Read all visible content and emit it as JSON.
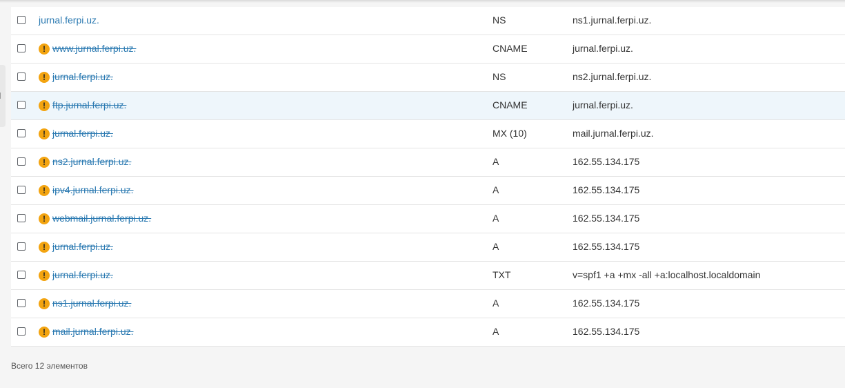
{
  "records": [
    {
      "host": "jurnal.ferpi.uz.",
      "type": "NS",
      "value": "ns1.jurnal.ferpi.uz.",
      "warning": false
    },
    {
      "host": "www.jurnal.ferpi.uz.",
      "type": "CNAME",
      "value": "jurnal.ferpi.uz.",
      "warning": true
    },
    {
      "host": "jurnal.ferpi.uz.",
      "type": "NS",
      "value": "ns2.jurnal.ferpi.uz.",
      "warning": true
    },
    {
      "host": "ftp.jurnal.ferpi.uz.",
      "type": "CNAME",
      "value": "jurnal.ferpi.uz.",
      "warning": true
    },
    {
      "host": "jurnal.ferpi.uz.",
      "type": "MX (10)",
      "value": "mail.jurnal.ferpi.uz.",
      "warning": true
    },
    {
      "host": "ns2.jurnal.ferpi.uz.",
      "type": "A",
      "value": "162.55.134.175",
      "warning": true
    },
    {
      "host": "ipv4.jurnal.ferpi.uz.",
      "type": "A",
      "value": "162.55.134.175",
      "warning": true
    },
    {
      "host": "webmail.jurnal.ferpi.uz.",
      "type": "A",
      "value": "162.55.134.175",
      "warning": true
    },
    {
      "host": "jurnal.ferpi.uz.",
      "type": "A",
      "value": "162.55.134.175",
      "warning": true
    },
    {
      "host": "jurnal.ferpi.uz.",
      "type": "TXT",
      "value": "v=spf1 +a +mx -all +a:localhost.localdomain",
      "warning": true
    },
    {
      "host": "ns1.jurnal.ferpi.uz.",
      "type": "A",
      "value": "162.55.134.175",
      "warning": true
    },
    {
      "host": "mail.jurnal.ferpi.uz.",
      "type": "A",
      "value": "162.55.134.175",
      "warning": true
    }
  ],
  "footer": {
    "total_label": "Всего 12 элементов"
  },
  "colors": {
    "link": "#2a79b1",
    "warning": "#f3a410",
    "row_hover": "#eef6fb"
  },
  "icons": {
    "warning": "exclamation-circle-icon",
    "checkbox": "checkbox-unchecked"
  }
}
